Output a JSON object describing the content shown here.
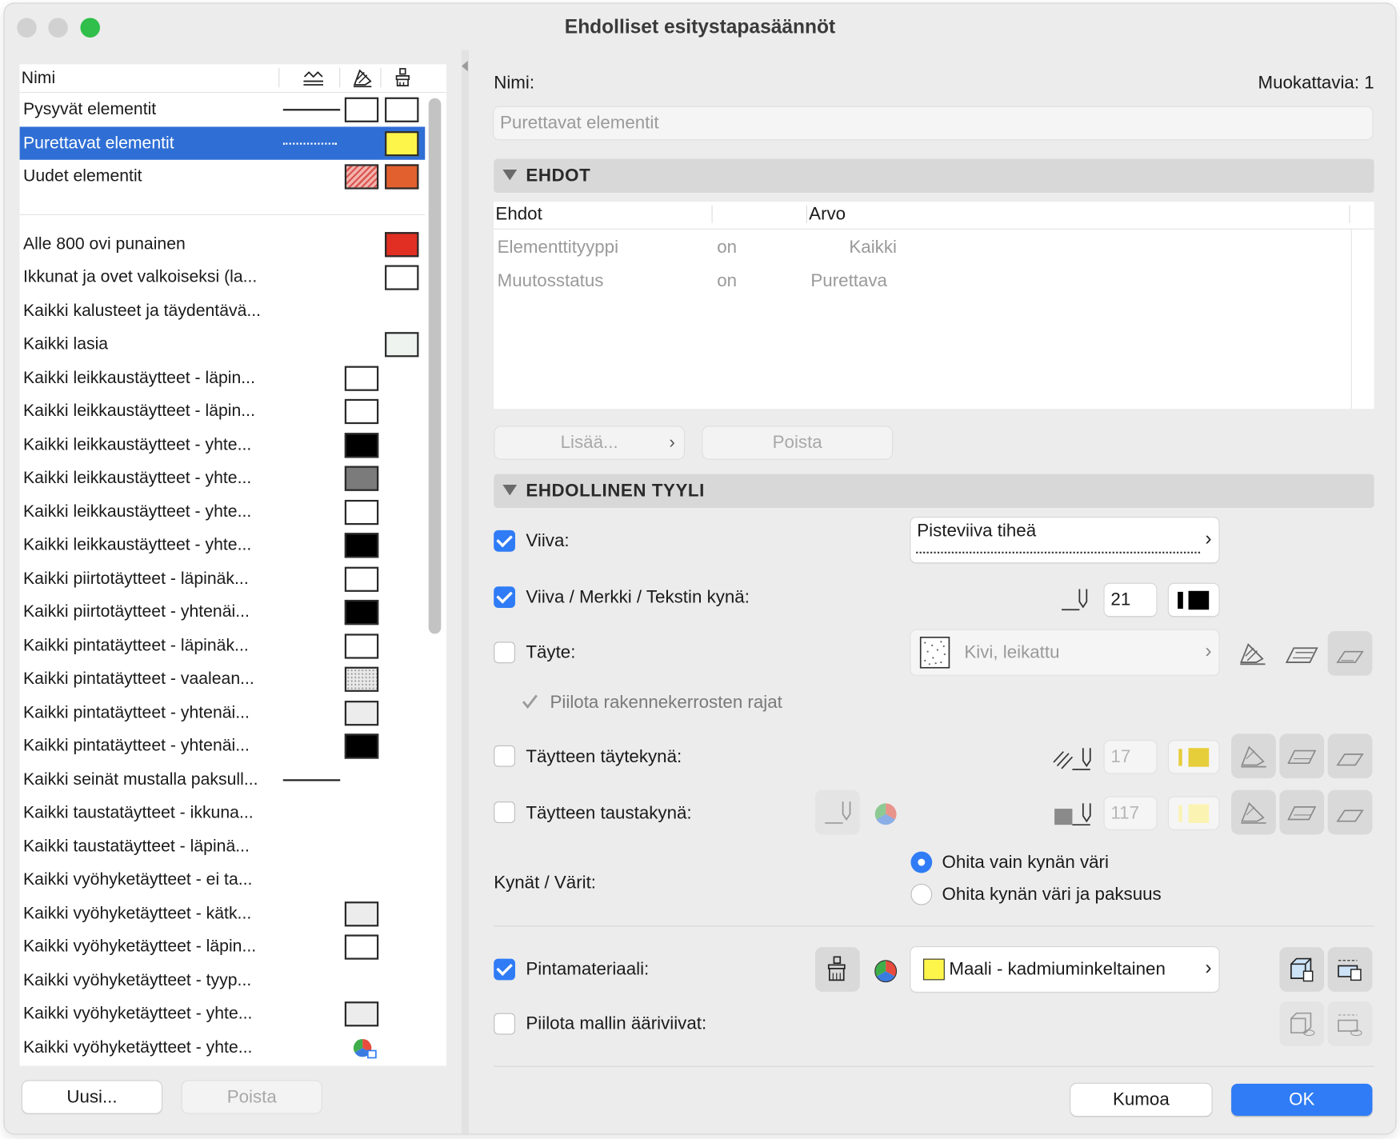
{
  "window": {
    "title": "Ehdolliset esitystapasäännöt",
    "traffic_lights": [
      "#d1d1d1",
      "#d1d1d1",
      "#2fbf4a"
    ]
  },
  "left": {
    "header": {
      "name_col": "Nimi",
      "col_icons": [
        "line-type-icon",
        "fill-icon",
        "surface-brush-icon"
      ]
    },
    "rows": [
      {
        "label": "Pysyvät elementit",
        "line": "solid",
        "c1": "#ffffff",
        "c2": "#ffffff"
      },
      {
        "label": "Purettavat elementit",
        "line": "dotted",
        "c2": "#fdf54a",
        "selected": true
      },
      {
        "label": "Uudet elementit",
        "c1": "hatch",
        "c2": "#e2602e"
      },
      {
        "label": "",
        "separator": true
      },
      {
        "label": "Alle 800 ovi punainen",
        "c2": "#e13023"
      },
      {
        "label": "Ikkunat ja ovet valkoiseksi (la...",
        "c2": "#ffffff"
      },
      {
        "label": "Kaikki kalusteet ja täydentävä..."
      },
      {
        "label": "Kaikki lasia",
        "c2": "#eef3f0"
      },
      {
        "label": "Kaikki leikkaustäytteet - läpin...",
        "c1": "#ffffff"
      },
      {
        "label": "Kaikki leikkaustäytteet - läpin...",
        "c1": "#ffffff"
      },
      {
        "label": "Kaikki leikkaustäytteet - yhte...",
        "c1": "#000000"
      },
      {
        "label": "Kaikki leikkaustäytteet - yhte...",
        "c1": "#7b7b7b"
      },
      {
        "label": "Kaikki leikkaustäytteet - yhte...",
        "c1": "#ffffff"
      },
      {
        "label": "Kaikki leikkaustäytteet - yhte...",
        "c1": "#000000"
      },
      {
        "label": "Kaikki piirtotäytteet - läpinäk...",
        "c1": "#ffffff"
      },
      {
        "label": "Kaikki piirtotäytteet - yhtenäi...",
        "c1": "#000000"
      },
      {
        "label": "Kaikki pintatäytteet - läpinäk...",
        "c1": "#ffffff"
      },
      {
        "label": "Kaikki pintatäytteet - vaalean...",
        "c1": "dots"
      },
      {
        "label": "Kaikki pintatäytteet - yhtenäi...",
        "c1": "#ececec"
      },
      {
        "label": "Kaikki pintatäytteet - yhtenäi...",
        "c1": "#000000"
      },
      {
        "label": "Kaikki seinät mustalla paksull...",
        "line": "solid"
      },
      {
        "label": "Kaikki taustatäytteet - ikkuna..."
      },
      {
        "label": "Kaikki taustatäytteet - läpinä..."
      },
      {
        "label": "Kaikki vyöhyketäytteet - ei ta..."
      },
      {
        "label": "Kaikki vyöhyketäytteet - kätk...",
        "c1": "#ececec"
      },
      {
        "label": "Kaikki vyöhyketäytteet - läpin...",
        "c1": "#ffffff"
      },
      {
        "label": "Kaikki vyöhyketäytteet - tyyp..."
      },
      {
        "label": "Kaikki vyöhyketäytteet - yhte...",
        "c1": "#ececec"
      },
      {
        "label": "Kaikki vyöhyketäytteet - yhte...",
        "c1": "pie"
      }
    ],
    "buttons": {
      "new": "Uusi...",
      "delete": "Poista"
    }
  },
  "right": {
    "name_label": "Nimi:",
    "editable_count": "Muokattavia: 1",
    "name_value": "Purettavat elementit",
    "conditions": {
      "title": "EHDOT",
      "headers": [
        "Ehdot",
        "",
        "Arvo"
      ],
      "rows": [
        {
          "criterion": "Elementtityyppi",
          "op": "on",
          "value": "Kaikki"
        },
        {
          "criterion": "Muutosstatus",
          "op": "on",
          "value": "Purettava"
        }
      ],
      "add_button": "Lisää...",
      "delete_button": "Poista"
    },
    "style": {
      "title": "EHDOLLINEN TYYLI",
      "line": {
        "label": "Viiva:",
        "checked": true,
        "value": "Pisteviiva tiheä"
      },
      "pen": {
        "label": "Viiva / Merkki / Tekstin kynä:",
        "checked": true,
        "value": "21"
      },
      "fill": {
        "label": "Täyte:",
        "checked": false,
        "value": "Kivi, leikattu"
      },
      "hide_layers": {
        "label": "Piilota rakennekerrosten rajat",
        "checked": true
      },
      "fill_pen": {
        "label": "Täytteen täytekynä:",
        "checked": false,
        "value": "17"
      },
      "bg_pen": {
        "label": "Täytteen taustakynä:",
        "checked": false,
        "value": "117"
      },
      "pens_colors": {
        "label": "Kynät / Värit:",
        "options": [
          "Ohita vain kynän väri",
          "Ohita kynän väri ja paksuus"
        ],
        "selected": 0
      },
      "surface": {
        "label": "Pintamateriaali:",
        "checked": true,
        "value": "Maali - kadmiuminkeltainen",
        "swatch": "#fdf54a"
      },
      "hide_contours": {
        "label": "Piilota mallin ääriviivat:",
        "checked": false
      }
    },
    "buttons": {
      "cancel": "Kumoa",
      "ok": "OK"
    },
    "accent": "#2f7cf6"
  }
}
